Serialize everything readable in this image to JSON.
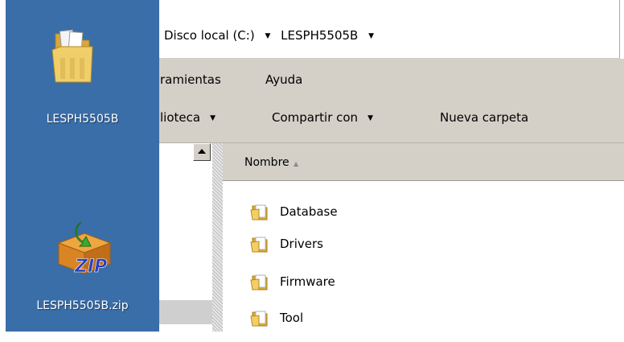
{
  "desktop": {
    "icons": [
      {
        "label": "LESPH5505B",
        "icon": "folder-icon"
      },
      {
        "label": "LESPH5505B.zip",
        "icon": "zip-archive-icon"
      }
    ]
  },
  "address": {
    "crumbs": [
      "Disco local (C:)",
      "LESPH5505B"
    ]
  },
  "menu": {
    "items": [
      "ramientas",
      "Ayuda"
    ]
  },
  "toolbar": {
    "items": [
      "lioteca",
      "Compartir con",
      "Nueva carpeta"
    ]
  },
  "list": {
    "column_name": "Nombre",
    "sort_indicator": "▲",
    "files": [
      "Database",
      "Drivers",
      "Firmware",
      "Tool"
    ]
  },
  "colors": {
    "desktop": "#3a6ea8",
    "chrome": "#d4d0c8",
    "folder": "#e8c25e"
  }
}
